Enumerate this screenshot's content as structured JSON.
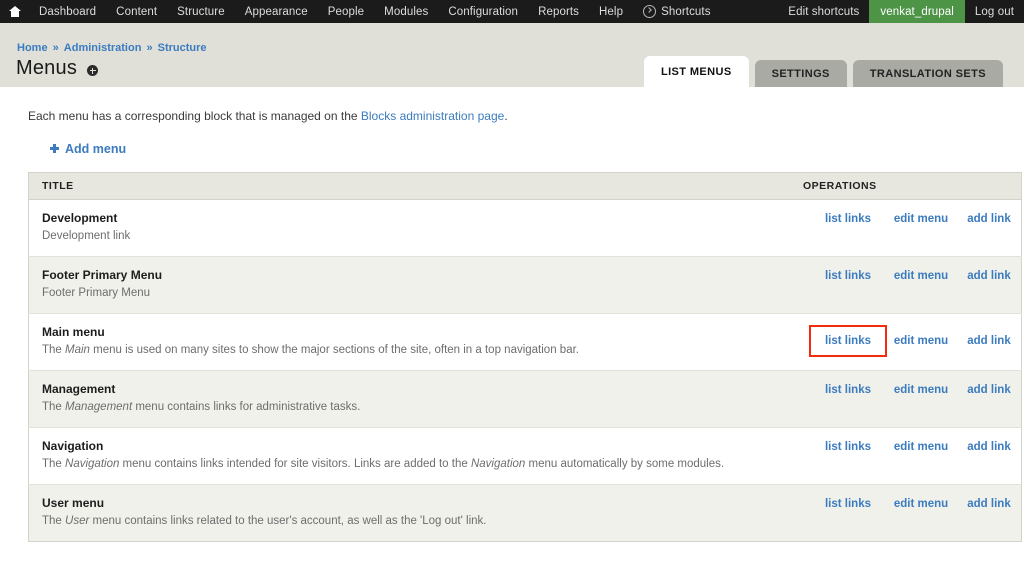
{
  "toolbar": {
    "home_icon": "home-icon",
    "left_items": [
      {
        "label": "Dashboard",
        "name": "toolbar-item-dashboard"
      },
      {
        "label": "Content",
        "name": "toolbar-item-content"
      },
      {
        "label": "Structure",
        "name": "toolbar-item-structure"
      },
      {
        "label": "Appearance",
        "name": "toolbar-item-appearance"
      },
      {
        "label": "People",
        "name": "toolbar-item-people"
      },
      {
        "label": "Modules",
        "name": "toolbar-item-modules"
      },
      {
        "label": "Configuration",
        "name": "toolbar-item-configuration"
      },
      {
        "label": "Reports",
        "name": "toolbar-item-reports"
      },
      {
        "label": "Help",
        "name": "toolbar-item-help"
      }
    ],
    "shortcuts_label": "Shortcuts",
    "shortcuts_icon": "chevron-right-circle-icon",
    "edit_shortcuts_label": "Edit shortcuts",
    "user_label": "venkat_drupal",
    "logout_label": "Log out",
    "user_badge_color": "#4e9447",
    "background_color": "#1b1b1b"
  },
  "breadcrumb": {
    "items": [
      "Home",
      "Administration",
      "Structure"
    ],
    "separator": "»"
  },
  "page": {
    "title": "Menus",
    "shortcut_icon": "add-shortcut-icon",
    "header_background": "#e0e0d9"
  },
  "tabs": [
    {
      "label": "LIST MENUS",
      "active": true,
      "name": "tab-list-menus"
    },
    {
      "label": "SETTINGS",
      "active": false,
      "name": "tab-settings"
    },
    {
      "label": "TRANSLATION SETS",
      "active": false,
      "name": "tab-translation-sets"
    }
  ],
  "intro": {
    "prefix": "Each menu has a corresponding block that is managed on the ",
    "link_text": "Blocks administration page",
    "suffix": "."
  },
  "add_menu": {
    "label": "Add menu",
    "icon": "plus-icon"
  },
  "table": {
    "headers": {
      "title": "TITLE",
      "operations": "OPERATIONS"
    },
    "ops_labels": {
      "list": "list links",
      "edit": "edit menu",
      "add": "add link"
    },
    "rows": [
      {
        "name": "Development",
        "desc_html": "Development link",
        "stripe": false,
        "highlight_list": false
      },
      {
        "name": "Footer Primary Menu",
        "desc_html": "Footer Primary Menu",
        "stripe": true,
        "highlight_list": false
      },
      {
        "name": "Main menu",
        "desc_html": "The <em>Main</em> menu is used on many sites to show the major sections of the site, often in a top navigation bar.",
        "stripe": false,
        "highlight_list": true
      },
      {
        "name": "Management",
        "desc_html": "The <em>Management</em> menu contains links for administrative tasks.",
        "stripe": true,
        "highlight_list": false
      },
      {
        "name": "Navigation",
        "desc_html": "The <em>Navigation</em> menu contains links intended for site visitors. Links are added to the <em>Navigation</em> menu automatically by some modules.",
        "stripe": false,
        "highlight_list": false
      },
      {
        "name": "User menu",
        "desc_html": "The <em>User</em> menu contains links related to the user's account, as well as the 'Log out' link.",
        "stripe": true,
        "highlight_list": false
      }
    ]
  },
  "colors": {
    "link": "#3b7bbf",
    "highlight_outline": "#f42c0e",
    "stripe": "#f1f1eb",
    "table_border": "#d3d3cb"
  }
}
